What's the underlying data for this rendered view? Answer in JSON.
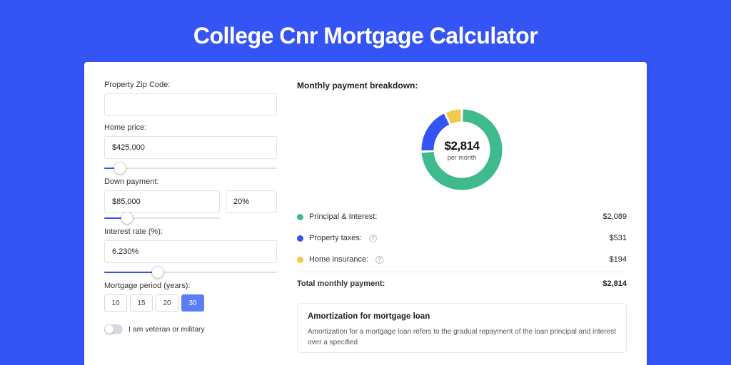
{
  "page": {
    "title": "College Cnr Mortgage Calculator"
  },
  "colors": {
    "principal": "#3fba8d",
    "taxes": "#3454f5",
    "insurance": "#f2c94c"
  },
  "form": {
    "zip": {
      "label": "Property Zip Code:",
      "value": "",
      "placeholder": ""
    },
    "home_price": {
      "label": "Home price:",
      "value": "$425,000",
      "slider_pct": 9
    },
    "down_payment": {
      "label": "Down payment:",
      "amount": "$85,000",
      "percent": "20%",
      "slider_pct": 20
    },
    "interest": {
      "label": "Interest rate (%):",
      "value": "6.230%",
      "slider_pct": 31
    },
    "period": {
      "label": "Mortgage period (years):",
      "options": [
        "10",
        "15",
        "20",
        "30"
      ],
      "selected": "30"
    },
    "veteran": {
      "label": "I am veteran or military",
      "checked": false
    }
  },
  "breakdown": {
    "title": "Monthly payment breakdown:",
    "center_amount": "$2,814",
    "center_sub": "per month",
    "items": [
      {
        "key": "principal",
        "label": "Principal & Interest:",
        "value": "$2,089",
        "numeric": 2089,
        "info": false
      },
      {
        "key": "taxes",
        "label": "Property taxes:",
        "value": "$531",
        "numeric": 531,
        "info": true
      },
      {
        "key": "insurance",
        "label": "Home insurance:",
        "value": "$194",
        "numeric": 194,
        "info": true
      }
    ],
    "total": {
      "label": "Total monthly payment:",
      "value": "$2,814"
    }
  },
  "amortization": {
    "title": "Amortization for mortgage loan",
    "body": "Amortization for a mortgage loan refers to the gradual repayment of the loan principal and interest over a specified"
  },
  "chart_data": {
    "type": "pie",
    "title": "Monthly payment breakdown",
    "series": [
      {
        "name": "Principal & Interest",
        "value": 2089
      },
      {
        "name": "Property taxes",
        "value": 531
      },
      {
        "name": "Home insurance",
        "value": 194
      }
    ],
    "total": 2814,
    "unit": "USD/month"
  }
}
